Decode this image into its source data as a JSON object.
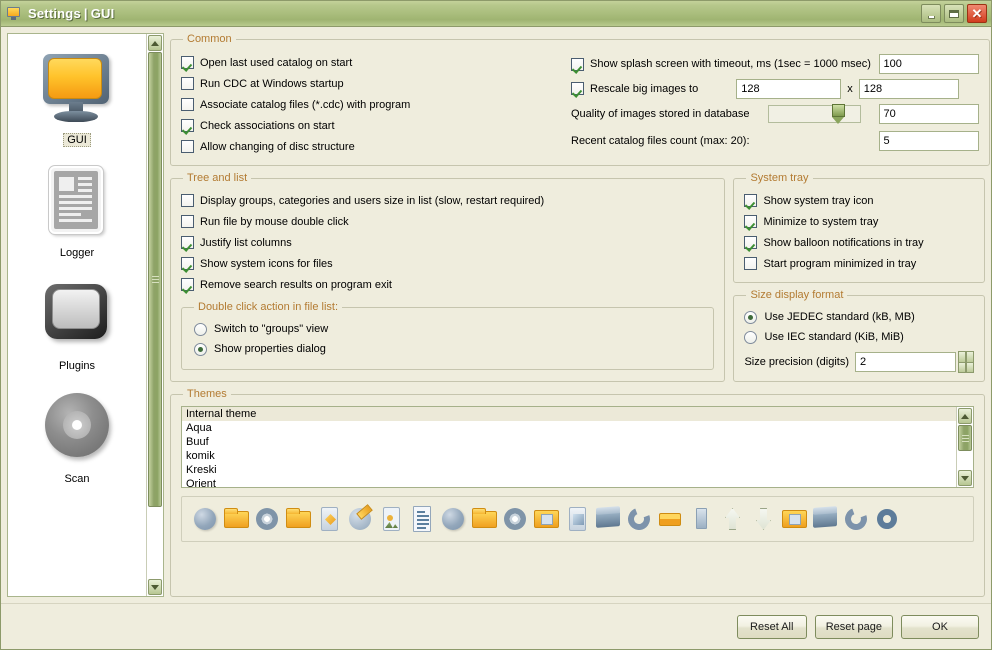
{
  "window": {
    "title_app": "Settings",
    "title_sep": "|",
    "title_page": "GUI",
    "icon": "monitor-icon",
    "minimize_label": "",
    "maximize_label": "",
    "close_label": "✕"
  },
  "sidebar": {
    "items": [
      {
        "label": "GUI",
        "icon": "monitor-icon",
        "selected": true
      },
      {
        "label": "Logger",
        "icon": "document-icon",
        "selected": false
      },
      {
        "label": "Plugins",
        "icon": "plugin-icon",
        "selected": false
      },
      {
        "label": "Scan",
        "icon": "disc-icon",
        "selected": false
      }
    ]
  },
  "common": {
    "legend": "Common",
    "checkboxes": [
      {
        "label": "Open last used catalog on start",
        "checked": true
      },
      {
        "label": "Run CDC at Windows startup",
        "checked": false
      },
      {
        "label": "Associate catalog files (*.cdc) with program",
        "checked": false
      },
      {
        "label": "Check associations on start",
        "checked": true
      },
      {
        "label": "Allow changing of disc structure",
        "checked": false
      }
    ],
    "splash": {
      "label": "Show splash screen with timeout, ms (1sec = 1000 msec)",
      "checked": true,
      "value": "100"
    },
    "rescale": {
      "label": "Rescale big images to",
      "checked": true,
      "width": "128",
      "times": "x",
      "height": "128"
    },
    "quality": {
      "label": "Quality of images stored in database",
      "value": "70",
      "slider_percent": 70
    },
    "recent": {
      "label": "Recent catalog files count (max: 20):",
      "value": "5"
    }
  },
  "tree_and_list": {
    "legend": "Tree and list",
    "checkboxes": [
      {
        "label": "Display groups, categories and users size in list (slow, restart required)",
        "checked": false
      },
      {
        "label": "Run file by mouse double click",
        "checked": false
      },
      {
        "label": "Justify list columns",
        "checked": true
      },
      {
        "label": "Show system icons for files",
        "checked": true
      },
      {
        "label": "Remove search results on program exit",
        "checked": true
      }
    ],
    "double_click": {
      "legend": "Double click action in file list:",
      "options": [
        {
          "label": "Switch to \"groups\" view",
          "selected": false
        },
        {
          "label": "Show properties dialog",
          "selected": true
        }
      ]
    }
  },
  "system_tray": {
    "legend": "System tray",
    "checkboxes": [
      {
        "label": "Show system tray icon",
        "checked": true
      },
      {
        "label": "Minimize to system tray",
        "checked": true
      },
      {
        "label": "Show balloon notifications in tray",
        "checked": true
      },
      {
        "label": "Start program minimized in tray",
        "checked": false
      }
    ]
  },
  "size_display_format": {
    "legend": "Size display format",
    "options": [
      {
        "label": "Use JEDEC standard (kB, MB)",
        "selected": true
      },
      {
        "label": "Use IEC standard (KiB, MiB)",
        "selected": false
      }
    ],
    "precision": {
      "label": "Size precision (digits)",
      "value": "2"
    }
  },
  "themes": {
    "legend": "Themes",
    "items": [
      {
        "label": "Internal theme",
        "selected": true
      },
      {
        "label": "Aqua",
        "selected": false
      },
      {
        "label": "Buuf",
        "selected": false
      },
      {
        "label": "komik",
        "selected": false
      },
      {
        "label": "Kreski",
        "selected": false
      },
      {
        "label": "Orient",
        "selected": false
      }
    ],
    "preview_icons": [
      "globe-icon",
      "folder-icon",
      "cd-icon",
      "folder-icon",
      "card-icon",
      "pen-icon",
      "image-icon",
      "text-document-icon",
      "globe-icon",
      "folder-icon",
      "cd-icon",
      "folder-image-icon",
      "card-icon",
      "box-icon",
      "ring-icon",
      "tab-icon",
      "bar-icon",
      "arrow-up-icon",
      "arrow-down-icon",
      "folder-image-icon",
      "box-icon",
      "ring-icon",
      "ring-solid-icon"
    ]
  },
  "footer": {
    "reset_all_label": "Reset All",
    "reset_page_label": "Reset page",
    "ok_label": "OK"
  },
  "colors": {
    "titlebar_green": "#a9bd7c",
    "legend_orange": "#b37b32",
    "panel_bg": "#efeddd",
    "check_green": "#3d8f33",
    "close_red": "#d23c1e"
  }
}
